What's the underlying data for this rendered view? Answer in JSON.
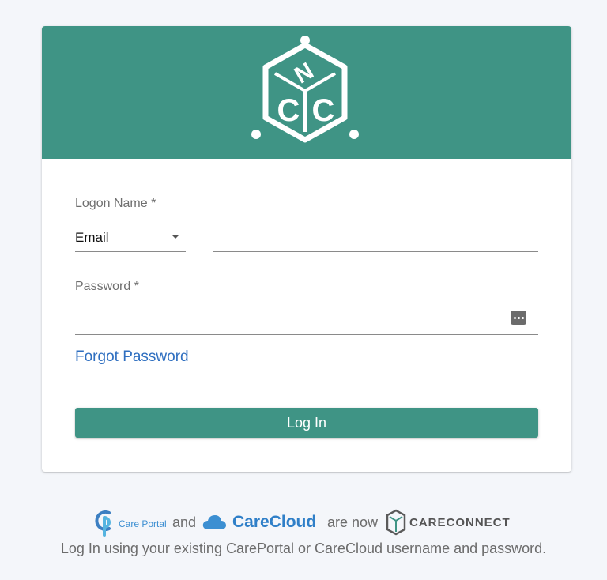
{
  "colors": {
    "brand": "#3f9485",
    "link": "#2f6fc0",
    "background": "#f4f6fa"
  },
  "header": {
    "logo_icon": "nc-cube-logo-icon"
  },
  "form": {
    "logon_name_label": "Logon Name *",
    "logon_type": {
      "selected": "Email"
    },
    "logon_name_value": "",
    "password_label": "Password *",
    "password_value": "",
    "password_manager_icon": "password-dots-icon",
    "forgot_password": "Forgot Password",
    "login_button": "Log In"
  },
  "footer": {
    "careportal_brand": "Care Portal",
    "and_text": "and",
    "carecloud_brand": "CareCloud",
    "are_now_text": "are now",
    "careconnect_brand": "CARECONNECT",
    "message": "Log In using your existing CarePortal or CareCloud username and password."
  }
}
